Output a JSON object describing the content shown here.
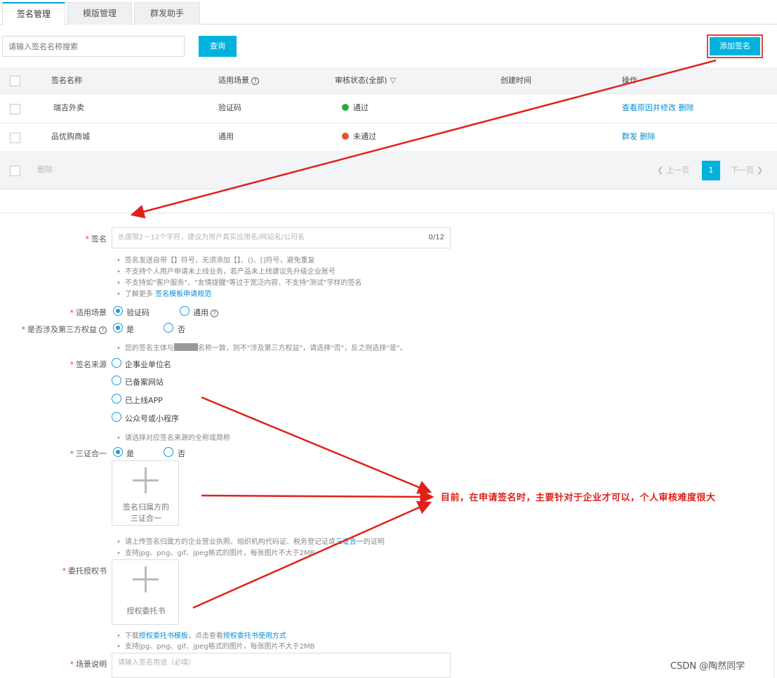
{
  "tabs": [
    "签名管理",
    "模版管理",
    "群发助手"
  ],
  "toolbar": {
    "search_placeholder": "请输入签名名称搜索",
    "query_label": "查询",
    "add_label": "添加签名"
  },
  "table": {
    "columns": [
      "签名名称",
      "适用场景",
      "审核状态(全部)",
      "创建时间",
      "操作"
    ],
    "rows": [
      {
        "name": "瑞吉外卖",
        "scene": "验证码",
        "status": "通过",
        "status_color": "#2eaa3a",
        "action1": "查看原因并修改",
        "action2": "删除"
      },
      {
        "name": "品优购商城",
        "scene": "通用",
        "status": "未通过",
        "status_color": "#e8502e",
        "action1": "群发",
        "action2": "删除"
      }
    ],
    "batch_delete": "删除",
    "pager": {
      "prev": "上一页",
      "current": "1",
      "next": "下一页"
    }
  },
  "form": {
    "signature": {
      "label": "签名",
      "placeholder": "长度限2－12个字符，建议为用户真实应用名/网站名/公司名",
      "counter": "0/12",
      "hints": [
        "签名发送自带【】符号，无须添加【】、()、[]符号，避免重复",
        "不支持个人用户申请未上线业务，若产品未上线建议先升级企业账号",
        "不支持如\"客户服务\"、\"友情提醒\"等过于宽泛内容、不支持\"测试\"字样的签名"
      ],
      "more_prefix": "了解更多",
      "more_link": "签名模板申请规范"
    },
    "scene": {
      "label": "适用场景",
      "options": [
        "验证码",
        "通用"
      ]
    },
    "third_party": {
      "label": "是否涉及第三方权益",
      "options": [
        "是",
        "否"
      ],
      "hint_before": "您的签名主体与",
      "hint_after": "名称一致，则不\"涉及第三方权益\"，请选择\"否\"，反之则选择\"是\"。"
    },
    "source": {
      "label": "签名来源",
      "options": [
        "企事业单位名",
        "已备案网站",
        "已上线APP",
        "公众号或小程序"
      ],
      "hint": "请选择对应签名来源的全称或简称"
    },
    "three_in_one": {
      "label": "三证合一",
      "options": [
        "是",
        "否"
      ],
      "upload_text": [
        "签名归属方的",
        "三证合一"
      ],
      "hint_1_before": "请上传签名归属方的企业营业执照、组织机构代码证、税务登记证或",
      "hint_1_link": "三证合一",
      "hint_1_after": "的证明",
      "hint_2": "支持jpg、png、gif、jpeg格式的图片，每张图片不大于2MB"
    },
    "authorization": {
      "label": "委托授权书",
      "upload_text": [
        "授权委托书"
      ],
      "hint_1_a": "下载",
      "hint_1_link_a": "授权委托书模板",
      "hint_1_b": "，点击查看",
      "hint_1_link_b": "授权委托书使用方式",
      "hint_2": "支持jpg、png、gif、jpeg格式的图片，每张图片不大于2MB"
    },
    "scenario_desc": {
      "label": "场景说明",
      "placeholder": "请输入签名用途（必填）"
    }
  },
  "annotation": "目前，在申请签名时，主要针对于企业才可以，个人审核难度很大",
  "watermark": "CSDN @陶然同学",
  "colors": {
    "accent": "#00b2dd",
    "annotation_red": "#e0211b",
    "link": "#0a8fd0"
  }
}
